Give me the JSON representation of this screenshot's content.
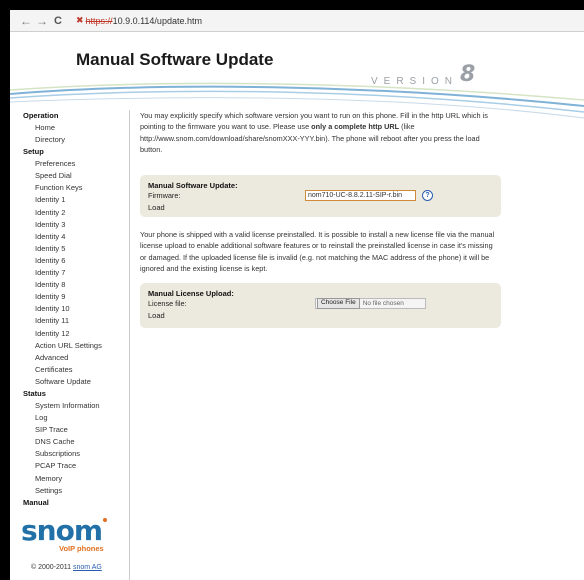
{
  "browser": {
    "url_protocol": "https://",
    "url_rest": "10.9.0.114/update.htm"
  },
  "header": {
    "title": "Manual Software Update",
    "version_label": "VERSION",
    "version_number": "8"
  },
  "sidebar": {
    "groups": [
      {
        "label": "Operation",
        "items": [
          "Home",
          "Directory"
        ]
      },
      {
        "label": "Setup",
        "items": [
          "Preferences",
          "Speed Dial",
          "Function Keys",
          "Identity 1",
          "Identity 2",
          "Identity 3",
          "Identity 4",
          "Identity 5",
          "Identity 6",
          "Identity 7",
          "Identity 8",
          "Identity 9",
          "Identity 10",
          "Identity 11",
          "Identity 12",
          "Action URL Settings",
          "Advanced",
          "Certificates",
          "Software Update"
        ]
      },
      {
        "label": "Status",
        "items": [
          "System Information",
          "Log",
          "SIP Trace",
          "DNS Cache",
          "Subscriptions",
          "PCAP Trace",
          "Memory",
          "Settings"
        ]
      },
      {
        "label": "Manual",
        "items": []
      }
    ],
    "logo_text": "snom",
    "logo_tagline": "VoIP phones",
    "copyright_prefix": "© 2000-2011",
    "copyright_link": "snom AG"
  },
  "main": {
    "intro_a": "You may explicitly specify which software version you want to run on this phone. Fill in the http URL which is pointing to the firmware you want to use. Please use ",
    "intro_bold": "only a complete http URL",
    "intro_b": " (like http://www.snom.com/download/share/snomXXX-YYY.bin). The phone will reboot after you press the load button.",
    "update_panel": {
      "title": "Manual Software Update:",
      "firmware_label": "Firmware:",
      "firmware_value": "nom710-UC-8.8.2.11-SIP-r.bin",
      "load_label": "Load"
    },
    "license_text": "Your phone is shipped with a valid license preinstalled. It is possible to install a new license file via the manual license upload to enable additional software features or to reinstall the preinstalled license in case it's missing or damaged. If the uploaded license file is invalid (e.g. not matching the MAC address of the phone) it will be ignored and the existing license is kept.",
    "license_panel": {
      "title": "Manual License Upload:",
      "file_label": "License file:",
      "choose_label": "Choose File",
      "no_file_label": "No file chosen",
      "load_label": "Load"
    }
  },
  "colors": {
    "brand_blue": "#2171a8",
    "brand_orange": "#e07020",
    "panel_bg": "#ece9de"
  }
}
